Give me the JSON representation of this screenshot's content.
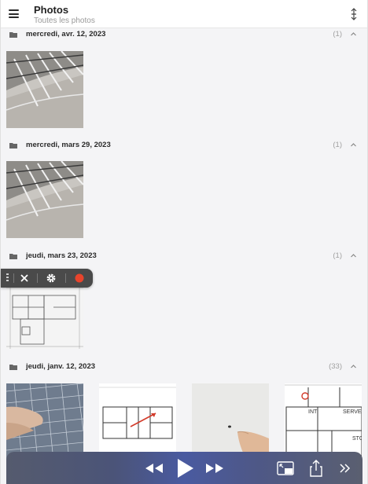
{
  "header": {
    "title": "Photos",
    "subtitle": "Toutes les photos"
  },
  "sections": [
    {
      "title": "mercredi, avr. 12, 2023",
      "count": "(1)"
    },
    {
      "title": "mercredi, mars 29, 2023",
      "count": "(1)"
    },
    {
      "title": "jeudi, mars 23, 2023",
      "count": "(1)"
    },
    {
      "title": "jeudi, janv. 12, 2023",
      "count": "(33)"
    }
  ],
  "icons": {
    "menu": "menu-icon",
    "sort": "sort-icon",
    "folder": "folder-icon",
    "collapse": "chevron-up-icon",
    "recorder_close": "close-icon",
    "recorder_settings": "gear-icon",
    "recorder_record": "record-icon",
    "rewind": "rewind-icon",
    "play": "play-icon",
    "fast_forward": "fast-forward-icon",
    "pip": "picture-in-picture-icon",
    "share": "share-icon",
    "more": "double-chevron-icon"
  },
  "colors": {
    "accent_record": "#e8442c",
    "player_tint": "#4a5aa0"
  }
}
